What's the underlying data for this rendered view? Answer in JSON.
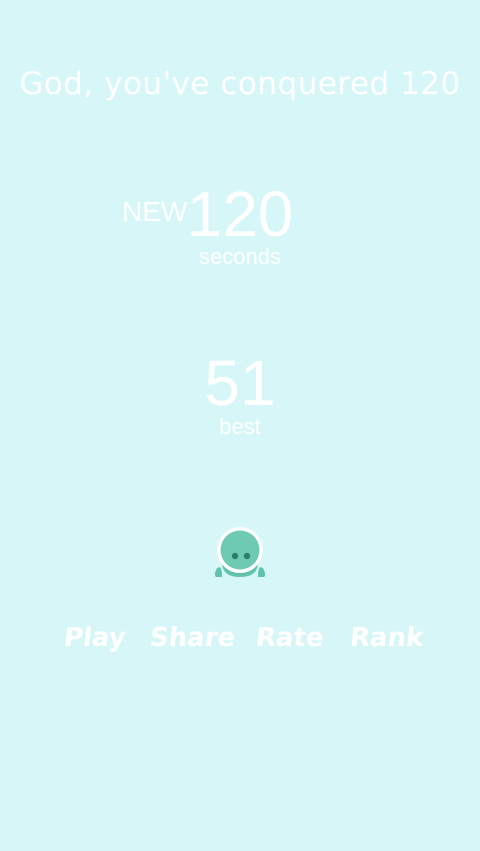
{
  "headline": "God, you've conquered 120",
  "result": {
    "new_tag": "NEW",
    "score": "120",
    "score_unit": "seconds"
  },
  "best": {
    "value": "51",
    "label": "best"
  },
  "mascot": {
    "icon": "astronaut-character-icon",
    "color": "#5fc3ac"
  },
  "menu": {
    "play": "Play",
    "share": "Share",
    "rate": "Rate",
    "rank": "Rank"
  },
  "colors": {
    "background": "#d6f6f8",
    "text": "#ffffff"
  }
}
